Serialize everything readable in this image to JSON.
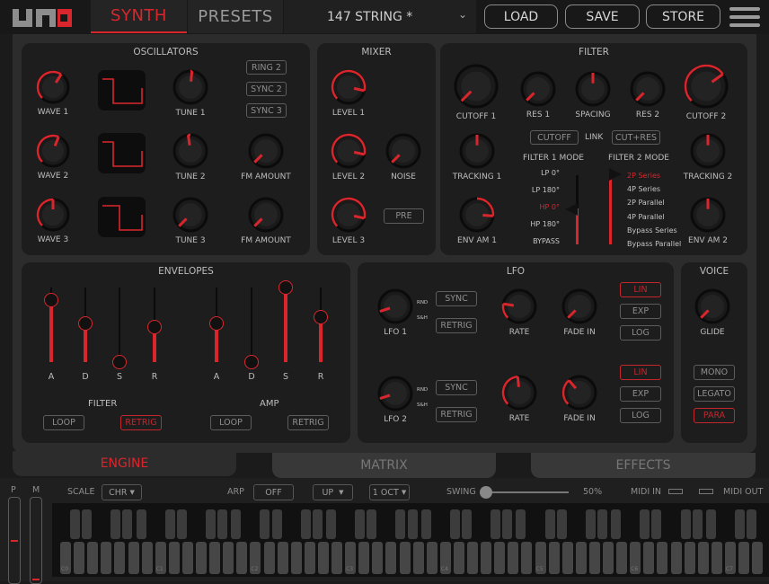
{
  "header": {
    "logo": "UNO",
    "tabs": [
      {
        "label": "SYNTH",
        "active": true
      },
      {
        "label": "PRESETS",
        "active": false
      }
    ],
    "preset_name": "147 STRING *",
    "buttons": {
      "load": "LOAD",
      "save": "SAVE",
      "store": "STORE"
    }
  },
  "colors": {
    "accent": "#d9262c",
    "panel": "#1d1d1d",
    "background": "#2c2c2c",
    "text": "#bdbdbd"
  },
  "oscillators": {
    "title": "OSCILLATORS",
    "wave": [
      {
        "label": "WAVE 1",
        "value": 0.62
      },
      {
        "label": "WAVE 2",
        "value": 0.58
      },
      {
        "label": "WAVE 3",
        "value": 0.5
      }
    ],
    "tune": [
      {
        "label": "TUNE 1",
        "value": 0.52
      },
      {
        "label": "TUNE 2",
        "value": 0.47
      },
      {
        "label": "TUNE 3",
        "value": 0.0
      }
    ],
    "fm": [
      {
        "label": "FM AMOUNT",
        "value": 0.0
      },
      {
        "label": "FM AMOUNT",
        "value": 0.0
      }
    ],
    "buttons": [
      {
        "label": "RING 2",
        "on": false
      },
      {
        "label": "SYNC 2",
        "on": false
      },
      {
        "label": "SYNC 3",
        "on": false
      }
    ]
  },
  "mixer": {
    "title": "MIXER",
    "levels": [
      {
        "label": "LEVEL 1",
        "value": 0.88
      },
      {
        "label": "LEVEL 2",
        "value": 0.88
      },
      {
        "label": "LEVEL 3",
        "value": 0.88
      }
    ],
    "noise": {
      "label": "NOISE",
      "value": 0.0
    },
    "pre": {
      "label": "PRE",
      "on": false
    }
  },
  "filter": {
    "title": "FILTER",
    "knobs": [
      {
        "label": "CUTOFF 1",
        "value": 0.0
      },
      {
        "label": "RES 1",
        "value": 0.0
      },
      {
        "label": "SPACING",
        "value": 0.5
      },
      {
        "label": "RES 2",
        "value": 0.0
      },
      {
        "label": "CUTOFF 2",
        "value": 0.7
      },
      {
        "label": "TRACKING 1",
        "value": 0.5
      },
      {
        "label": "ENV AM 1",
        "value": 0.85
      },
      {
        "label": "TRACKING 2",
        "value": 0.5
      },
      {
        "label": "ENV AM 2",
        "value": 0.5
      }
    ],
    "link_label": "LINK",
    "link_buttons": [
      {
        "label": "CUTOFF",
        "on": false
      },
      {
        "label": "CUT+RES",
        "on": false
      }
    ],
    "mode1_title": "FILTER 1 MODE",
    "mode1_options": [
      "LP 0°",
      "LP 180°",
      "HP 0°",
      "HP 180°",
      "BYPASS"
    ],
    "mode1_selected": "HP 0°",
    "mode2_title": "FILTER 2 MODE",
    "mode2_options": [
      "2P Series",
      "4P Series",
      "2P Parallel",
      "4P Parallel",
      "Bypass Series",
      "Bypass Parallel"
    ],
    "mode2_selected": "2P Series"
  },
  "envelopes": {
    "title": "ENVELOPES",
    "filter": {
      "label": "FILTER",
      "sliders": [
        {
          "label": "A",
          "value": 0.83
        },
        {
          "label": "D",
          "value": 0.52
        },
        {
          "label": "S",
          "value": 0.0
        },
        {
          "label": "R",
          "value": 0.47
        }
      ],
      "loop": "LOOP",
      "loop_on": false,
      "retrig": "RETRIG",
      "retrig_on": true
    },
    "amp": {
      "label": "AMP",
      "sliders": [
        {
          "label": "A",
          "value": 0.52
        },
        {
          "label": "D",
          "value": 0.0
        },
        {
          "label": "S",
          "value": 1.0
        },
        {
          "label": "R",
          "value": 0.6
        }
      ],
      "loop": "LOOP",
      "loop_on": false,
      "retrig": "RETRIG",
      "retrig_on": false
    }
  },
  "lfo": {
    "title": "LFO",
    "rows": [
      {
        "label": "LFO 1",
        "shape": 0.1,
        "sync": "SYNC",
        "retrig": "RETRIG",
        "rate": {
          "label": "RATE",
          "value": 0.2
        },
        "fade": {
          "label": "FADE IN",
          "value": 0.0
        },
        "curves": [
          {
            "label": "LIN",
            "on": true
          },
          {
            "label": "EXP",
            "on": false
          },
          {
            "label": "LOG",
            "on": false
          }
        ]
      },
      {
        "label": "LFO 2",
        "shape": 0.1,
        "sync": "SYNC",
        "retrig": "RETRIG",
        "rate": {
          "label": "RATE",
          "value": 0.48
        },
        "fade": {
          "label": "FADE IN",
          "value": 0.35
        },
        "curves": [
          {
            "label": "LIN",
            "on": true
          },
          {
            "label": "EXP",
            "on": false
          },
          {
            "label": "LOG",
            "on": false
          }
        ]
      }
    ],
    "shape_labels": [
      "RND",
      "S&H"
    ]
  },
  "voice": {
    "title": "VOICE",
    "glide": {
      "label": "GLIDE",
      "value": 0.0
    },
    "modes": [
      {
        "label": "MONO",
        "on": false
      },
      {
        "label": "LEGATO",
        "on": false
      },
      {
        "label": "PARA",
        "on": true
      }
    ]
  },
  "engine_tabs": [
    {
      "label": "ENGINE",
      "active": true
    },
    {
      "label": "MATRIX",
      "active": false
    },
    {
      "label": "EFFECTS",
      "active": false
    }
  ],
  "bottom": {
    "pitch_label": "P",
    "mod_label": "M",
    "pitch_value": 0.5,
    "mod_value": 0.0,
    "scale_label": "SCALE",
    "scale_value": "CHR",
    "arp_label": "ARP",
    "arp_value": "OFF",
    "arp_direction": "UP",
    "arp_octave": "1 OCT",
    "swing_label": "SWING",
    "swing_value": "50%",
    "swing_fraction": 0.0,
    "midi_in": "MIDI IN",
    "midi_out": "MIDI OUT",
    "octave_labels": [
      "C0",
      "C1",
      "C2",
      "C3",
      "C4",
      "C5",
      "C6",
      "C7"
    ]
  }
}
